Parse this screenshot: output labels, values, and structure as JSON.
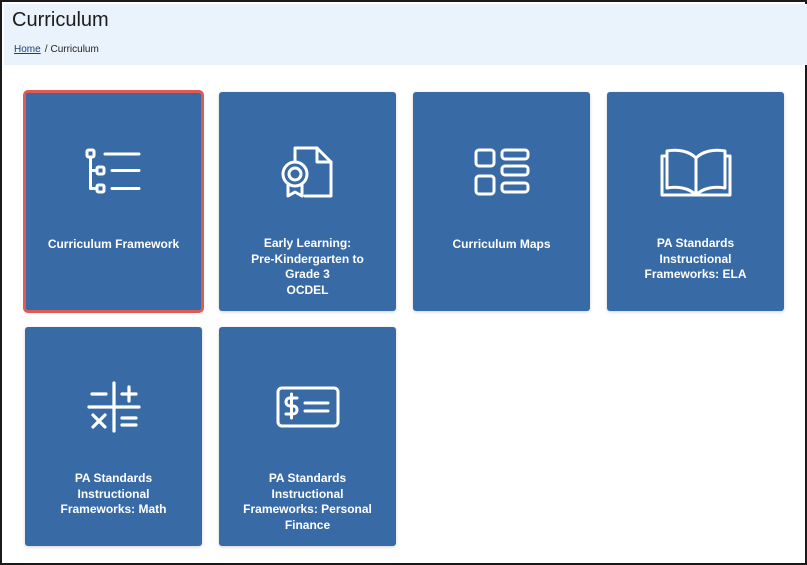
{
  "header": {
    "title": "Curriculum",
    "breadcrumb": {
      "home": "Home",
      "separator": "/",
      "current": "Curriculum"
    }
  },
  "tiles": [
    {
      "label": "Curriculum Framework",
      "icon": "tree-list-icon",
      "selected": true
    },
    {
      "label": "Early Learning:\nPre-Kindergarten to\nGrade 3\nOCDEL",
      "icon": "certificate-document-icon"
    },
    {
      "label": "Curriculum Maps",
      "icon": "grid-layout-icon"
    },
    {
      "label": "PA Standards\nInstructional\nFrameworks: ELA",
      "icon": "open-book-icon"
    },
    {
      "label": "PA Standards\nInstructional\nFrameworks: Math",
      "icon": "math-operators-icon"
    },
    {
      "label": "PA Standards\nInstructional\nFrameworks: Personal\nFinance",
      "icon": "dollar-bill-icon"
    }
  ],
  "colors": {
    "tile": "#386aa6",
    "header_bg": "#eaf2fb",
    "selected_outline": "#e05a55"
  }
}
